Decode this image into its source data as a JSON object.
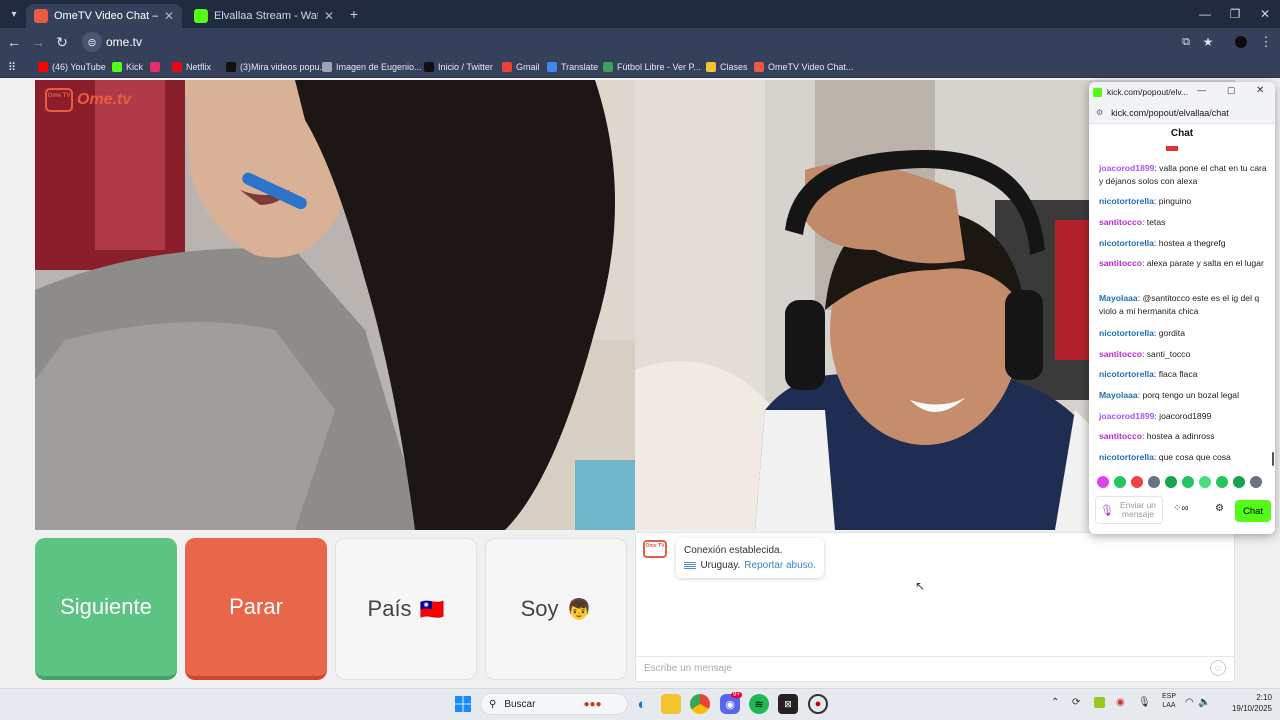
{
  "browser": {
    "tabs": [
      {
        "title": "OmeTV Video Chat — Ome",
        "active": true
      },
      {
        "title": "Elvallaa Stream - Watch Live on",
        "active": false
      }
    ],
    "new_tab_label": "+",
    "address": "ome.tv",
    "bookmarks": [
      {
        "label": "(46) YouTube",
        "color": "#ff0000"
      },
      {
        "label": "Kick",
        "color": "#53fc18"
      },
      {
        "label": "",
        "color": "#e1306c"
      },
      {
        "label": "Netflix",
        "color": "#e50914"
      },
      {
        "label": "(3)Mira videos popu...",
        "color": "#111111"
      },
      {
        "label": "Imagen de Eugenio...",
        "color": "#9aa4b5"
      },
      {
        "label": "Inicio / Twitter",
        "color": "#111111"
      },
      {
        "label": "Gmail",
        "color": "#ea4335"
      },
      {
        "label": "Translate",
        "color": "#4285f4"
      },
      {
        "label": "Fútbol Libre - Ver P...",
        "color": "#3aa35a"
      },
      {
        "label": "Clases",
        "color": "#f4c430"
      },
      {
        "label": "OmeTV Video Chat...",
        "color": "#e85c43"
      }
    ]
  },
  "ometv": {
    "logo_text": "Ome.tv",
    "logo_badge": "Ome TV",
    "buttons": {
      "next": "Siguiente",
      "stop": "Parar",
      "country": "País",
      "country_flag": "🇹🇼",
      "gender": "Soy",
      "gender_emoji": "👦"
    },
    "status_line1": "Conexión establecida.",
    "status_country": "Uruguay.",
    "report_link": "Reportar abuso.",
    "message_placeholder": "Escribe un mensaje"
  },
  "kick_popup": {
    "window_title": "kick.com/popout/elv...",
    "url": "kick.com/popout/elvallaa/chat",
    "header": "Chat",
    "messages": [
      {
        "user": "joacorod1899",
        "color": "#a855f7",
        "text": ": valla pone el chat en tu cara y déjanos solos con alexa"
      },
      {
        "user": "nicotortorella",
        "color": "#1e6fb5",
        "text": ": pinguino"
      },
      {
        "user": "santitocco",
        "color": "#c026d3",
        "text": ": tetas"
      },
      {
        "user": "nicotortorella",
        "color": "#1e6fb5",
        "text": ": hostea a thegrefg"
      },
      {
        "user": "santitocco",
        "color": "#c026d3",
        "text": ": alexa parate y salta en el lugar"
      },
      {
        "user": "Mayolaaa",
        "color": "#1e6fb5",
        "text": ": @santitocco este es el ig del q violo a mi hermanita chica"
      },
      {
        "user": "nicotortorella",
        "color": "#1e6fb5",
        "text": ": gordita"
      },
      {
        "user": "santitocco",
        "color": "#c026d3",
        "text": ": santi_tocco"
      },
      {
        "user": "nicotortorella",
        "color": "#1e6fb5",
        "text": ": flaca flaca"
      },
      {
        "user": "Mayolaaa",
        "color": "#1e6fb5",
        "text": ": porq tengo un bozal legal"
      },
      {
        "user": "joacorod1899",
        "color": "#a855f7",
        "text": ": joacorod1899"
      },
      {
        "user": "santitocco",
        "color": "#c026d3",
        "text": ": hostea a adinross"
      },
      {
        "user": "nicotortorella",
        "color": "#1e6fb5",
        "text": ": que cosa que cosa"
      }
    ],
    "input_placeholder": "Enviar un mensaje",
    "send_button": "Chat",
    "accent": "#53fc18"
  },
  "taskbar": {
    "search_label": "Buscar",
    "lang_top": "ESP",
    "lang_bottom": "LAA",
    "time": "2:10",
    "date": "19/10/2025",
    "discord_badge": "9+"
  }
}
